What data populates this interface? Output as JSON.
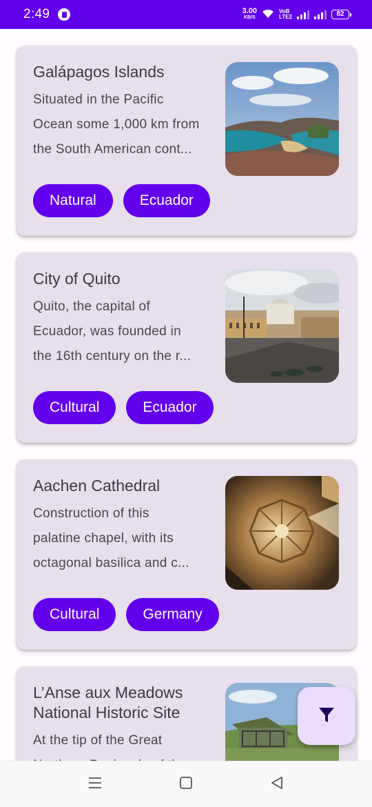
{
  "status_bar": {
    "time": "2:49",
    "net_speed_value": "3.00",
    "net_speed_unit": "KB/S",
    "volte_top": "VoB",
    "volte_bottom": "LTE2",
    "battery": "82"
  },
  "cards": [
    {
      "title": "Galápagos Islands",
      "description": [
        "Situated in the Pacific",
        "Ocean some 1,000 km from",
        "the South American cont..."
      ],
      "tags": [
        "Natural",
        "Ecuador"
      ]
    },
    {
      "title": "City of Quito",
      "description": [
        "Quito, the capital of",
        "Ecuador, was founded in",
        "the 16th century on the r..."
      ],
      "tags": [
        "Cultural",
        "Ecuador"
      ]
    },
    {
      "title": "Aachen Cathedral",
      "description": [
        "Construction of this",
        "palatine chapel, with its",
        "octagonal basilica and c..."
      ],
      "tags": [
        "Cultural",
        "Germany"
      ]
    },
    {
      "title_lines": [
        "L’Anse aux Meadows",
        "National Historic Site"
      ],
      "description": [
        "At the tip of the Great",
        "Northern Peninsula of the"
      ]
    }
  ],
  "fab": {
    "icon": "filter-icon"
  },
  "nav": {
    "icons": [
      "menu-icon",
      "home-square-icon",
      "back-triangle-icon"
    ]
  },
  "colors": {
    "primary": "#6200ee",
    "card": "#e7e0ec",
    "fab": "#eaddff"
  }
}
